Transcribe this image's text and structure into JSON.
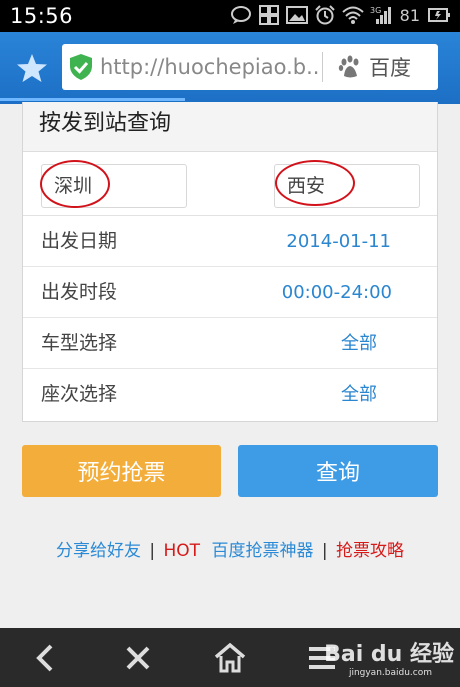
{
  "status_bar": {
    "time": "15:56",
    "network": "3G",
    "battery": "81"
  },
  "browser": {
    "url": "http://huochepiao.b...",
    "search_engine": "百度",
    "accent": "#1f74c9"
  },
  "card": {
    "title": "按发到站查询",
    "from_station": "深圳",
    "to_station": "西安",
    "rows": [
      {
        "label": "出发日期",
        "value": "2014-01-11"
      },
      {
        "label": "出发时段",
        "value": "00:00-24:00"
      },
      {
        "label": "车型选择",
        "value": "全部"
      },
      {
        "label": "座次选择",
        "value": "全部"
      }
    ]
  },
  "buttons": {
    "reserve": "预约抢票",
    "query": "查询",
    "reserve_color": "#f3ad3a",
    "query_color": "#3e9be6"
  },
  "links": {
    "share": "分享给好友",
    "sep": "|",
    "hot": "HOT",
    "baidu_tool": "百度抢票神器",
    "guide": "抢票攻略"
  },
  "bottom_nav": {
    "icons": [
      "back-icon",
      "close-icon",
      "home-icon",
      "menu-icon"
    ],
    "watermark": "Bai du 经验",
    "watermark_sub": "jingyan.baidu.com"
  }
}
